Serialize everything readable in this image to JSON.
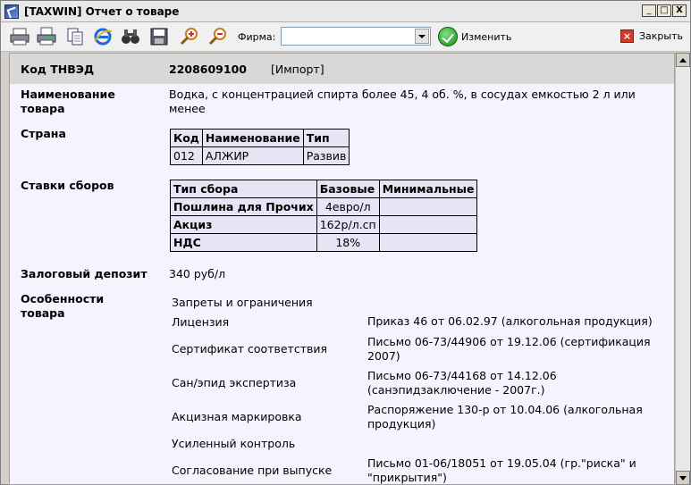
{
  "window": {
    "title": "[TAXWIN] Отчет о товаре",
    "minimize": "_",
    "maximize": "□",
    "close": "X"
  },
  "toolbar": {
    "firm_label": "Фирма:",
    "firm_value": "",
    "change_label": "Изменить",
    "close_label": "Закрыть",
    "icons": [
      "print-icon",
      "print-preview-icon",
      "copy-icon",
      "browser-icon",
      "binoculars-icon",
      "save-icon",
      "zoom-in-icon",
      "zoom-out-icon"
    ]
  },
  "report": {
    "code_label": "Код ТНВЭД",
    "code_value": "2208609100",
    "code_tag": "[Импорт]",
    "name_label": "Наименование товара",
    "name_value": "Водка, с концентрацией спирта более 45, 4 об. %, в сосудах емкостью 2 л или менее",
    "country_label": "Страна",
    "country_table": {
      "headers": [
        "Код",
        "Наименование",
        "Тип"
      ],
      "row": [
        "012",
        "АЛЖИР",
        "Развив"
      ]
    },
    "rates_label": "Ставки сборов",
    "rates_table": {
      "headers": [
        "Тип сбора",
        "Базовые",
        "Минимальные"
      ],
      "rows": [
        [
          "Пошлина для Прочих",
          "4евро/л",
          ""
        ],
        [
          "Акциз",
          "162р/л.сп",
          ""
        ],
        [
          "НДС",
          "18%",
          ""
        ]
      ]
    },
    "deposit_label": "Залоговый депозит",
    "deposit_value": "340 руб/л",
    "features_label": "Особенности товара",
    "features": [
      {
        "label": "Запреты и ограничения",
        "value": ""
      },
      {
        "label": "Лицензия",
        "value": "Приказ 46 от 06.02.97 (алкогольная продукция)"
      },
      {
        "label": "Сертификат соответствия",
        "value": "Письмо 06-73/44906 от 19.12.06 (сертификация 2007)"
      },
      {
        "label": "Сан/эпид экспертиза",
        "value": "Письмо 06-73/44168 от 14.12.06 (санэпидзаключение - 2007г.)"
      },
      {
        "label": "Акцизная маркировка",
        "value": "Распоряжение 130-р от 10.04.06 (алкогольная продукция)"
      },
      {
        "label": "Усиленный контроль",
        "value": ""
      },
      {
        "label": "Согласование при выпуске",
        "value": "Письмо 01-06/18051 от 19.05.04 (гр.\"риска\" и \"прикрытия\")"
      }
    ]
  }
}
